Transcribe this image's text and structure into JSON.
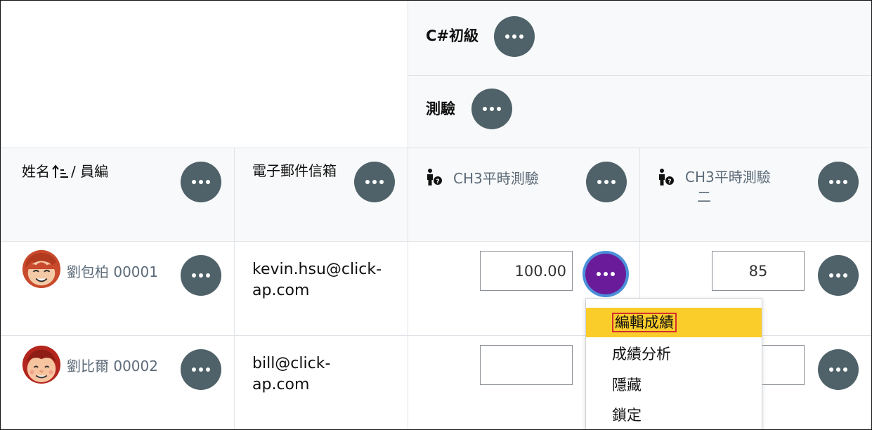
{
  "header": {
    "category_title": "C#初級",
    "subcategory_title": "測驗"
  },
  "columns": {
    "name_label": "姓名",
    "separator": "/ 員編",
    "email_label": "電子郵件信箱",
    "item1_label": "CH3平時測驗",
    "item2_label_line1": "CH3平時測驗",
    "item2_label_line2": "二"
  },
  "rows": [
    {
      "name": "劉包柏 00001",
      "email_line1": "kevin.hsu@click-",
      "email_line2": "ap.com",
      "grade1": "100.00",
      "grade2": "85"
    },
    {
      "name": "劉比爾 00002",
      "email_line1": "bill@click-",
      "email_line2": "ap.com",
      "grade1": "",
      "grade2": ""
    }
  ],
  "menu": {
    "items": [
      "編輯成績",
      "成績分析",
      "隱藏",
      "鎖定"
    ],
    "highlighted_index": 0
  },
  "colors": {
    "action_button": "#4f6269",
    "active_button": "#6a1b9a",
    "focus_ring": "#4a90d9",
    "menu_highlight": "#fbcd2b",
    "highlight_border": "#d32f2f"
  },
  "icons": {
    "sort": "sort-ascending-icon",
    "grade_item": "manual-grade-item-icon",
    "actions": "ellipsis-icon"
  }
}
